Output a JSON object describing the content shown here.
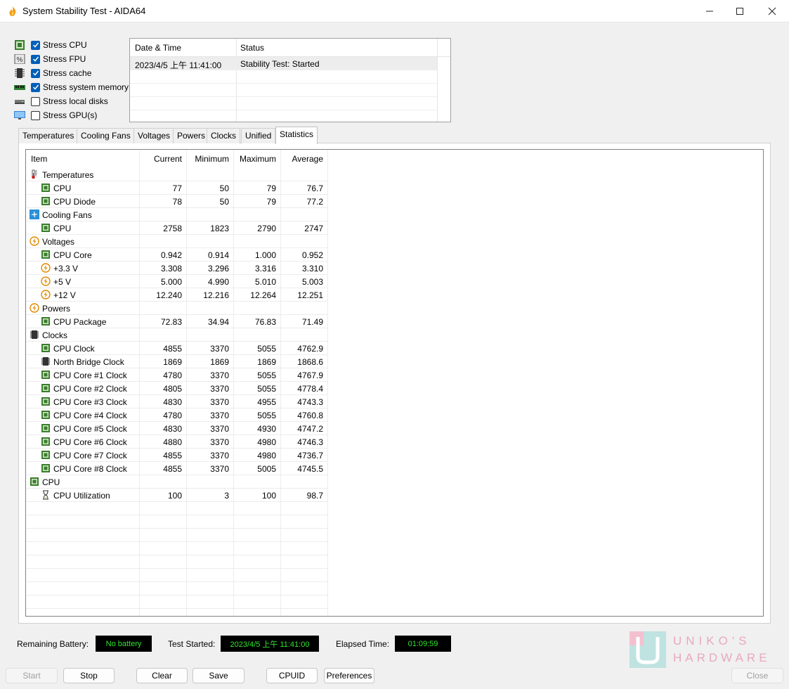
{
  "window": {
    "title": "System Stability Test - AIDA64"
  },
  "stress_options": [
    {
      "label": "Stress CPU",
      "checked": true,
      "icon": "cpu-chip-icon"
    },
    {
      "label": "Stress FPU",
      "checked": true,
      "icon": "fpu-icon"
    },
    {
      "label": "Stress cache",
      "checked": true,
      "icon": "cache-icon"
    },
    {
      "label": "Stress system memory",
      "checked": true,
      "icon": "memory-icon"
    },
    {
      "label": "Stress local disks",
      "checked": false,
      "icon": "disk-icon"
    },
    {
      "label": "Stress GPU(s)",
      "checked": false,
      "icon": "monitor-icon"
    }
  ],
  "log": {
    "columns": [
      "Date & Time",
      "Status"
    ],
    "rows": [
      {
        "datetime": "2023/4/5 上午 11:41:00",
        "status": "Stability Test: Started"
      }
    ]
  },
  "tabs": [
    "Temperatures",
    "Cooling Fans",
    "Voltages",
    "Powers",
    "Clocks",
    "Unified",
    "Statistics"
  ],
  "active_tab": "Statistics",
  "statistics": {
    "columns": [
      "Item",
      "Current",
      "Minimum",
      "Maximum",
      "Average"
    ],
    "rows": [
      {
        "type": "group",
        "name": "Temperatures",
        "icon": "thermometer-icon"
      },
      {
        "type": "item",
        "name": "CPU",
        "icon": "cpu-chip-icon",
        "current": "77",
        "minimum": "50",
        "maximum": "79",
        "average": "76.7"
      },
      {
        "type": "item",
        "name": "CPU Diode",
        "icon": "cpu-chip-icon",
        "current": "78",
        "minimum": "50",
        "maximum": "79",
        "average": "77.2"
      },
      {
        "type": "group",
        "name": "Cooling Fans",
        "icon": "fan-icon"
      },
      {
        "type": "item",
        "name": "CPU",
        "icon": "cpu-chip-icon",
        "current": "2758",
        "minimum": "1823",
        "maximum": "2790",
        "average": "2747"
      },
      {
        "type": "group",
        "name": "Voltages",
        "icon": "bolt-icon"
      },
      {
        "type": "item",
        "name": "CPU Core",
        "icon": "cpu-chip-icon",
        "current": "0.942",
        "minimum": "0.914",
        "maximum": "1.000",
        "average": "0.952"
      },
      {
        "type": "item",
        "name": "+3.3 V",
        "icon": "bolt-icon",
        "current": "3.308",
        "minimum": "3.296",
        "maximum": "3.316",
        "average": "3.310"
      },
      {
        "type": "item",
        "name": "+5 V",
        "icon": "bolt-icon",
        "current": "5.000",
        "minimum": "4.990",
        "maximum": "5.010",
        "average": "5.003"
      },
      {
        "type": "item",
        "name": "+12 V",
        "icon": "bolt-icon",
        "current": "12.240",
        "minimum": "12.216",
        "maximum": "12.264",
        "average": "12.251"
      },
      {
        "type": "group",
        "name": "Powers",
        "icon": "bolt-icon"
      },
      {
        "type": "item",
        "name": "CPU Package",
        "icon": "cpu-chip-icon",
        "current": "72.83",
        "minimum": "34.94",
        "maximum": "76.83",
        "average": "71.49"
      },
      {
        "type": "group",
        "name": "Clocks",
        "icon": "chip-icon"
      },
      {
        "type": "item",
        "name": "CPU Clock",
        "icon": "cpu-chip-icon",
        "current": "4855",
        "minimum": "3370",
        "maximum": "5055",
        "average": "4762.9"
      },
      {
        "type": "item",
        "name": "North Bridge Clock",
        "icon": "chip-icon",
        "current": "1869",
        "minimum": "1869",
        "maximum": "1869",
        "average": "1868.6"
      },
      {
        "type": "item",
        "name": "CPU Core #1 Clock",
        "icon": "cpu-chip-icon",
        "current": "4780",
        "minimum": "3370",
        "maximum": "5055",
        "average": "4767.9"
      },
      {
        "type": "item",
        "name": "CPU Core #2 Clock",
        "icon": "cpu-chip-icon",
        "current": "4805",
        "minimum": "3370",
        "maximum": "5055",
        "average": "4778.4"
      },
      {
        "type": "item",
        "name": "CPU Core #3 Clock",
        "icon": "cpu-chip-icon",
        "current": "4830",
        "minimum": "3370",
        "maximum": "4955",
        "average": "4743.3"
      },
      {
        "type": "item",
        "name": "CPU Core #4 Clock",
        "icon": "cpu-chip-icon",
        "current": "4780",
        "minimum": "3370",
        "maximum": "5055",
        "average": "4760.8"
      },
      {
        "type": "item",
        "name": "CPU Core #5 Clock",
        "icon": "cpu-chip-icon",
        "current": "4830",
        "minimum": "3370",
        "maximum": "4930",
        "average": "4747.2"
      },
      {
        "type": "item",
        "name": "CPU Core #6 Clock",
        "icon": "cpu-chip-icon",
        "current": "4880",
        "minimum": "3370",
        "maximum": "4980",
        "average": "4746.3"
      },
      {
        "type": "item",
        "name": "CPU Core #7 Clock",
        "icon": "cpu-chip-icon",
        "current": "4855",
        "minimum": "3370",
        "maximum": "4980",
        "average": "4736.7"
      },
      {
        "type": "item",
        "name": "CPU Core #8 Clock",
        "icon": "cpu-chip-icon",
        "current": "4855",
        "minimum": "3370",
        "maximum": "5005",
        "average": "4745.5"
      },
      {
        "type": "group",
        "name": "CPU",
        "icon": "cpu-chip-icon"
      },
      {
        "type": "item",
        "name": "CPU Utilization",
        "icon": "hourglass-icon",
        "current": "100",
        "minimum": "3",
        "maximum": "100",
        "average": "98.7"
      }
    ]
  },
  "status_bar": {
    "battery_label": "Remaining Battery:",
    "battery_value": "No battery",
    "started_label": "Test Started:",
    "started_value": "2023/4/5 上午 11:41:00",
    "elapsed_label": "Elapsed Time:",
    "elapsed_value": "01:09:59"
  },
  "buttons": {
    "start": "Start",
    "stop": "Stop",
    "clear": "Clear",
    "save": "Save",
    "cpuid": "CPUID",
    "preferences": "Preferences",
    "close": "Close"
  },
  "watermark": {
    "line1": "UNIKO'S",
    "line2": "HARDWARE"
  },
  "colors": {
    "accent": "#005fb8",
    "lcd_text": "#2ee62e",
    "chip_green": "#3a7d2c",
    "bolt_orange": "#e08a00",
    "fan_blue": "#2a8fd8"
  }
}
